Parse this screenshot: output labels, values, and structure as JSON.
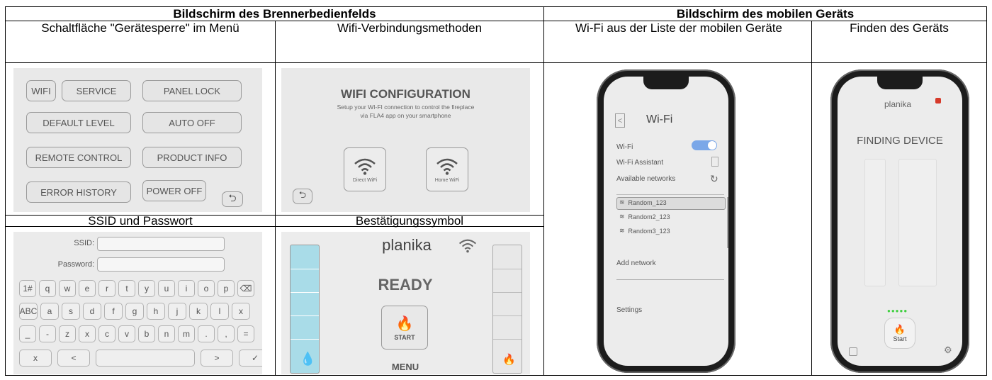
{
  "headers": {
    "burner_panel": "Bildschirm des Brennerbedienfelds",
    "mobile_device": "Bildschirm des mobilen Geräts"
  },
  "subheaders": {
    "device_lock_button": "Schaltfläche \"Gerätesperre\" im Menü",
    "wifi_methods": "Wifi-Verbindungsmethoden",
    "wifi_from_list": "Wi-Fi aus der Liste der mobilen Geräte",
    "finding_device": "Finden des Geräts",
    "ssid_password": "SSID und Passwort",
    "confirmation_icon": "Bestätigungssymbol"
  },
  "menu_panel": {
    "wifi": "WIFI",
    "service": "SERVICE",
    "panel_lock": "PANEL LOCK",
    "default_level": "DEFAULT LEVEL",
    "auto_off": "AUTO OFF",
    "remote_control": "REMOTE CONTROL",
    "product_info": "PRODUCT INFO",
    "error_history": "ERROR HISTORY",
    "power_off": "POWER OFF",
    "back_icon": "back-arrow-icon"
  },
  "wifi_config_panel": {
    "title": "WIFI CONFIGURATION",
    "subtitle_line1": "Setup your WI-FI connection to control the fireplace",
    "subtitle_line2": "via FLA4 app on your smartphone",
    "direct_wifi": "Direct WiFi",
    "home_wifi": "Home WiFi"
  },
  "ssid_panel": {
    "ssid_label": "SSID:",
    "password_label": "Password:",
    "keys_row1": [
      "1#",
      "q",
      "w",
      "e",
      "r",
      "t",
      "y",
      "u",
      "i",
      "o",
      "p",
      "⌫"
    ],
    "keys_row2": [
      "ABC",
      "a",
      "s",
      "d",
      "f",
      "g",
      "h",
      "j",
      "k",
      "l",
      "x"
    ],
    "keys_row3": [
      "_",
      "-",
      "z",
      "x",
      "c",
      "v",
      "b",
      "n",
      "m",
      ".",
      ",",
      "="
    ],
    "keys_row4": [
      "x",
      "<",
      "",
      ">",
      "✓"
    ]
  },
  "ready_panel": {
    "brand": "planika",
    "status": "READY",
    "start": "START",
    "menu": "MENU"
  },
  "phone_wifi": {
    "title": "Wi-Fi",
    "wifi_label": "Wi-Fi",
    "assistant": "Wi-Fi Assistant",
    "available": "Available networks",
    "networks": [
      "Random_123",
      "Random2_123",
      "Random3_123"
    ],
    "add_network": "Add network",
    "settings": "Settings"
  },
  "phone_finding": {
    "brand": "planika",
    "title": "FINDING DEVICE",
    "start": "Start"
  },
  "colors": {
    "panel_bg": "#e9e9e9",
    "toggle_blue": "#7aa7e8",
    "ready_blue": "#a9dce8",
    "lock_red": "#d63a2a",
    "progress_green": "#3fcf3f"
  }
}
